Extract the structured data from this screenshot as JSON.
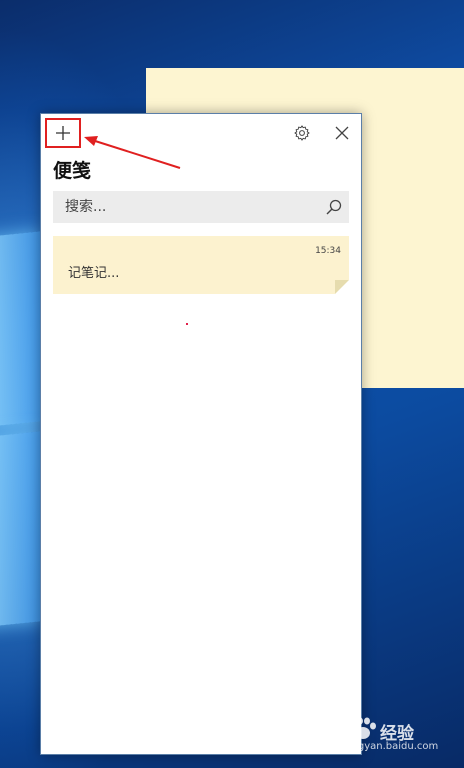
{
  "panel": {
    "title": "便笺",
    "search": {
      "placeholder": "搜索..."
    },
    "buttons": {
      "add_icon": "plus-icon",
      "settings_icon": "gear-icon",
      "close_icon": "close-icon"
    }
  },
  "notes": [
    {
      "time": "15:34",
      "text": "记笔记..."
    }
  ],
  "watermark": {
    "brand": "经验",
    "url": "jingyan.baidu.com"
  },
  "colors": {
    "note_bg": "#fcf2cf",
    "annotation": "#e02020",
    "panel_border": "#5b7fa8"
  }
}
